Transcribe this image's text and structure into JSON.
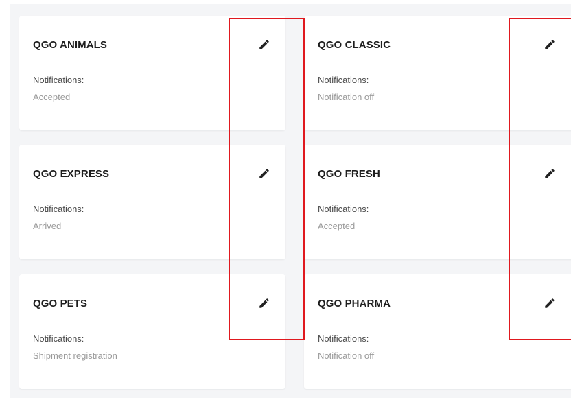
{
  "notifications_label": "Notifications:",
  "cards": [
    {
      "title": "QGO ANIMALS",
      "status": "Accepted"
    },
    {
      "title": "QGO CLASSIC",
      "status": "Notification off"
    },
    {
      "title": "QGO EXPRESS",
      "status": "Arrived"
    },
    {
      "title": "QGO FRESH",
      "status": "Accepted"
    },
    {
      "title": "QGO PETS",
      "status": "Shipment registration"
    },
    {
      "title": "QGO PHARMA",
      "status": "Notification off"
    }
  ],
  "icons": {
    "edit": "pencil-icon"
  },
  "colors": {
    "highlight": "#e0191f"
  }
}
